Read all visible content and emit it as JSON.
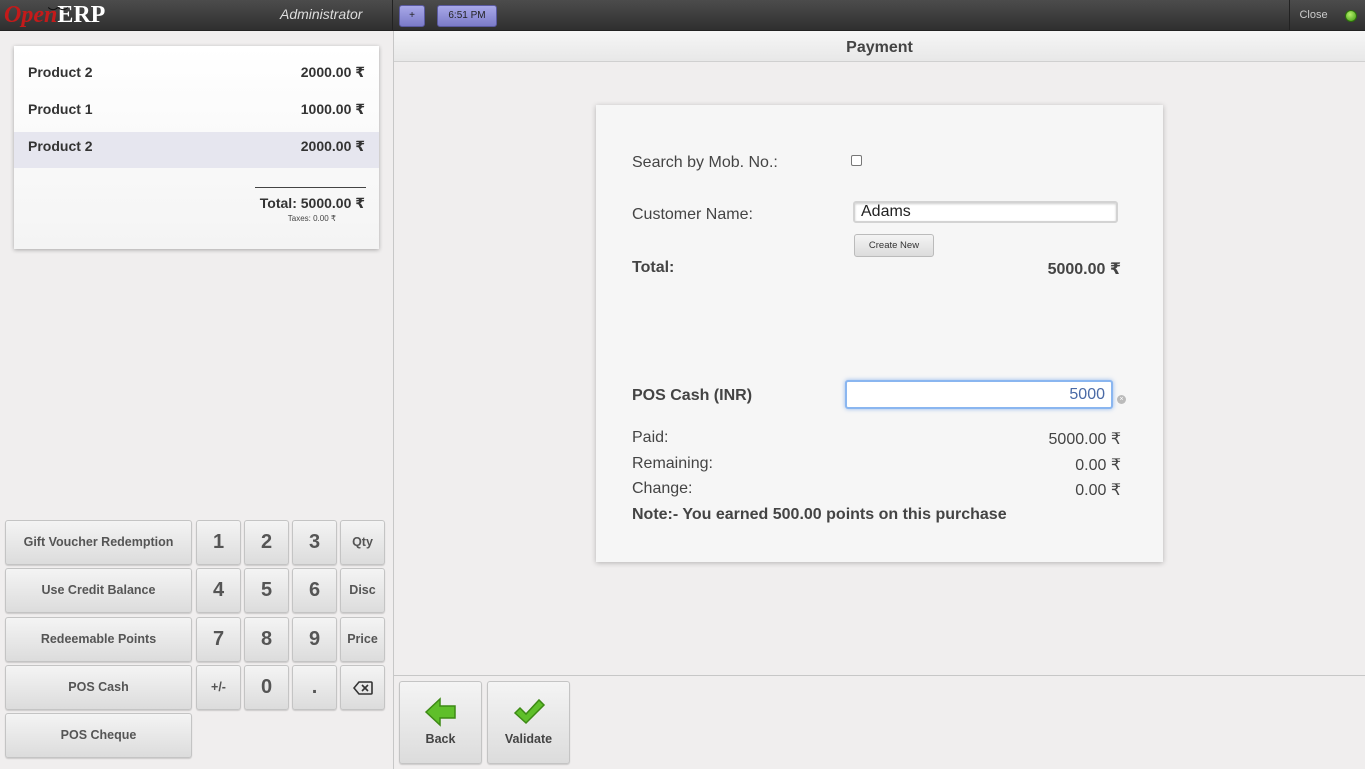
{
  "topbar": {
    "logo_open": "Open",
    "logo_erp": "ERP",
    "user": "Administrator",
    "add_label": "+",
    "clock": "6:51 PM",
    "close_label": "Close"
  },
  "order": {
    "lines": [
      {
        "name": "Product 2",
        "price": "2000.00 ₹"
      },
      {
        "name": "Product 1",
        "price": "1000.00 ₹"
      },
      {
        "name": "Product 2",
        "price": "2000.00 ₹"
      }
    ],
    "total": "Total: 5000.00 ₹",
    "taxes": "Taxes: 0.00 ₹"
  },
  "paypad": {
    "gift_voucher": "Gift Voucher Redemption",
    "credit_balance": "Use Credit Balance",
    "redeemable_points": "Redeemable Points",
    "pos_cash": "POS Cash",
    "pos_cheque": "POS Cheque"
  },
  "numpad": {
    "k1": "1",
    "k2": "2",
    "k3": "3",
    "k4": "4",
    "k5": "5",
    "k6": "6",
    "k7": "7",
    "k8": "8",
    "k9": "9",
    "k0": "0",
    "plusminus": "+/-",
    "dot": ".",
    "qty": "Qty",
    "disc": "Disc",
    "price": "Price"
  },
  "payment": {
    "header": "Payment",
    "search_mob_label": "Search by Mob. No.:",
    "customer_label": "Customer Name:",
    "customer_value": "Adams",
    "create_new": "Create New",
    "total_label": "Total:",
    "total_value": "5000.00 ₹",
    "method_label": "POS Cash (INR)",
    "method_amount": "5000",
    "paid_label": "Paid:",
    "paid_value": "5000.00 ₹",
    "remaining_label": "Remaining:",
    "remaining_value": "0.00 ₹",
    "change_label": "Change:",
    "change_value": "0.00 ₹",
    "note": "Note:- You earned 500.00 points on this purchase"
  },
  "actions": {
    "back": "Back",
    "validate": "Validate"
  },
  "colors": {
    "accent_blue": "#8ab6f0",
    "status_green": "#3c9a10",
    "logo_red": "#c41a1a"
  }
}
